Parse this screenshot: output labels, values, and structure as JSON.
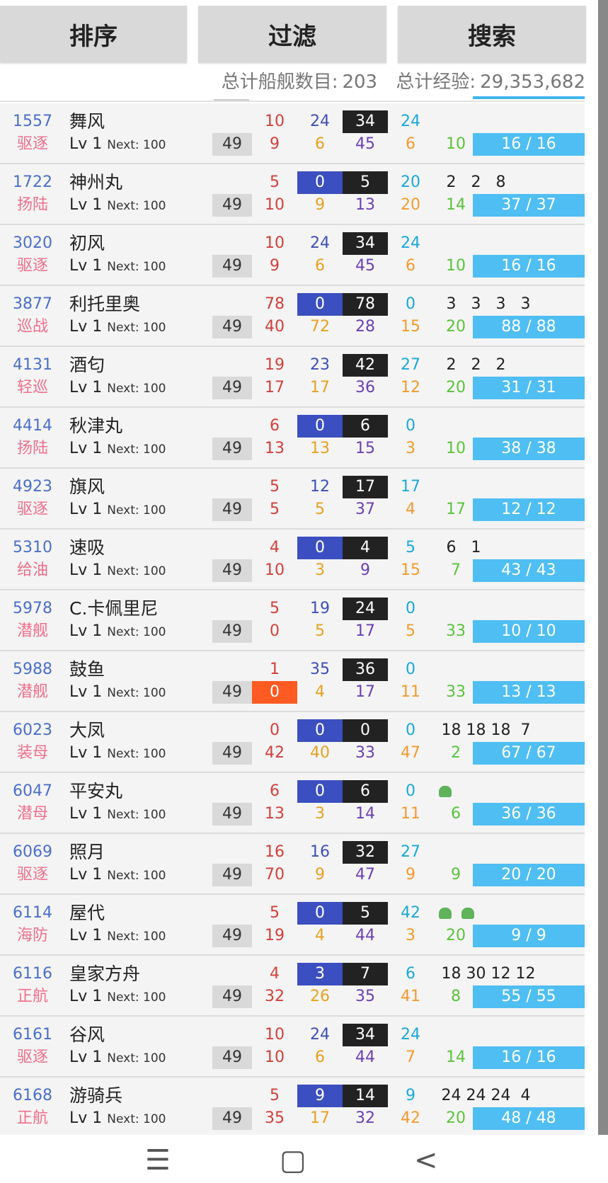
{
  "toolbar": {
    "sort_label": "排序",
    "filter_label": "过滤",
    "search_label": "搜索"
  },
  "summary": {
    "ships_label": "总计船舰数目:",
    "ships_value": "203",
    "exp_label": "总计经验:",
    "exp_value": "29,353,682"
  },
  "level_prefix": "Lv 1",
  "next_text": "Next: 100",
  "nav": {
    "menu_icon": "menu-icon",
    "home_icon": "home-icon",
    "back_icon": "back-icon"
  },
  "colors": {
    "accent": "#4fbef2",
    "torpedo_box": "#3b4fc0",
    "total_box": "#222222",
    "warn_box": "#ff5a22"
  },
  "ships": [
    {
      "id": "1557",
      "type": "驱逐",
      "name": "舞风",
      "lvbox": "49",
      "r1": [
        "10",
        "24",
        "34",
        "24"
      ],
      "r2": [
        "9",
        "6",
        "45",
        "6",
        "10"
      ],
      "slots": [],
      "hp": "16 / 16",
      "torp_box": false,
      "warn": false
    },
    {
      "id": "1722",
      "type": "扬陆",
      "name": "神州丸",
      "lvbox": "49",
      "r1": [
        "5",
        "0",
        "5",
        "20"
      ],
      "r2": [
        "10",
        "9",
        "13",
        "20",
        "14"
      ],
      "slots": [
        "2",
        "2",
        "8"
      ],
      "hp": "37 / 37",
      "torp_box": true,
      "warn": false
    },
    {
      "id": "3020",
      "type": "驱逐",
      "name": "初风",
      "lvbox": "49",
      "r1": [
        "10",
        "24",
        "34",
        "24"
      ],
      "r2": [
        "9",
        "6",
        "45",
        "6",
        "10"
      ],
      "slots": [],
      "hp": "16 / 16",
      "torp_box": false,
      "warn": false
    },
    {
      "id": "3877",
      "type": "巡战",
      "name": "利托里奥",
      "lvbox": "49",
      "r1": [
        "78",
        "0",
        "78",
        "0"
      ],
      "r2": [
        "40",
        "72",
        "28",
        "15",
        "20"
      ],
      "slots": [
        "3",
        "3",
        "3",
        "3"
      ],
      "hp": "88 / 88",
      "torp_box": true,
      "warn": false
    },
    {
      "id": "4131",
      "type": "轻巡",
      "name": "酒匂",
      "lvbox": "49",
      "r1": [
        "19",
        "23",
        "42",
        "27"
      ],
      "r2": [
        "17",
        "17",
        "36",
        "12",
        "20"
      ],
      "slots": [
        "2",
        "2",
        "2"
      ],
      "hp": "31 / 31",
      "torp_box": false,
      "warn": false
    },
    {
      "id": "4414",
      "type": "扬陆",
      "name": "秋津丸",
      "lvbox": "49",
      "r1": [
        "6",
        "0",
        "6",
        "0"
      ],
      "r2": [
        "13",
        "13",
        "15",
        "3",
        "10"
      ],
      "slots": [],
      "hp": "38 / 38",
      "torp_box": true,
      "warn": false
    },
    {
      "id": "4923",
      "type": "驱逐",
      "name": "旗风",
      "lvbox": "49",
      "r1": [
        "5",
        "12",
        "17",
        "17"
      ],
      "r2": [
        "5",
        "5",
        "37",
        "4",
        "17"
      ],
      "slots": [],
      "hp": "12 / 12",
      "torp_box": false,
      "warn": false
    },
    {
      "id": "5310",
      "type": "给油",
      "name": "速吸",
      "lvbox": "49",
      "r1": [
        "4",
        "0",
        "4",
        "5"
      ],
      "r2": [
        "10",
        "3",
        "9",
        "15",
        "7"
      ],
      "slots": [
        "6",
        "1"
      ],
      "hp": "43 / 43",
      "torp_box": true,
      "warn": false
    },
    {
      "id": "5978",
      "type": "潜舰",
      "name": "C.卡佩里尼",
      "lvbox": "49",
      "r1": [
        "5",
        "19",
        "24",
        "0"
      ],
      "r2": [
        "0",
        "5",
        "17",
        "5",
        "33"
      ],
      "slots": [],
      "hp": "10 / 10",
      "torp_box": false,
      "warn": false
    },
    {
      "id": "5988",
      "type": "潜舰",
      "name": "鼓鱼",
      "lvbox": "49",
      "r1": [
        "1",
        "35",
        "36",
        "0"
      ],
      "r2": [
        "0",
        "4",
        "17",
        "11",
        "33"
      ],
      "slots": [],
      "hp": "13 / 13",
      "torp_box": false,
      "warn": true
    },
    {
      "id": "6023",
      "type": "装母",
      "name": "大凤",
      "lvbox": "49",
      "r1": [
        "0",
        "0",
        "0",
        "0"
      ],
      "r2": [
        "42",
        "40",
        "33",
        "47",
        "2"
      ],
      "slots": [
        "18",
        "18",
        "18",
        "7"
      ],
      "hp": "67 / 67",
      "torp_box": true,
      "warn": false
    },
    {
      "id": "6047",
      "type": "潜母",
      "name": "平安丸",
      "lvbox": "49",
      "r1": [
        "6",
        "0",
        "6",
        "0"
      ],
      "r2": [
        "13",
        "3",
        "14",
        "11",
        "6"
      ],
      "slots": [],
      "icons": [
        "green"
      ],
      "hp": "36 / 36",
      "torp_box": true,
      "warn": false
    },
    {
      "id": "6069",
      "type": "驱逐",
      "name": "照月",
      "lvbox": "49",
      "r1": [
        "16",
        "16",
        "32",
        "27"
      ],
      "r2": [
        "70",
        "9",
        "47",
        "9",
        "9"
      ],
      "slots": [],
      "hp": "20 / 20",
      "torp_box": false,
      "warn": false
    },
    {
      "id": "6114",
      "type": "海防",
      "name": "屋代",
      "lvbox": "49",
      "r1": [
        "5",
        "0",
        "5",
        "42"
      ],
      "r2": [
        "19",
        "4",
        "44",
        "3",
        "20"
      ],
      "slots": [],
      "icons": [
        "green",
        "green"
      ],
      "hp": "9 / 9",
      "torp_box": true,
      "warn": false
    },
    {
      "id": "6116",
      "type": "正航",
      "name": "皇家方舟",
      "lvbox": "49",
      "r1": [
        "4",
        "3",
        "7",
        "6"
      ],
      "r2": [
        "32",
        "26",
        "35",
        "41",
        "8"
      ],
      "slots": [
        "18",
        "30",
        "12",
        "12"
      ],
      "hp": "55 / 55",
      "torp_box": true,
      "warn": false
    },
    {
      "id": "6161",
      "type": "驱逐",
      "name": "谷风",
      "lvbox": "49",
      "r1": [
        "10",
        "24",
        "34",
        "24"
      ],
      "r2": [
        "10",
        "6",
        "44",
        "7",
        "14"
      ],
      "slots": [],
      "hp": "16 / 16",
      "torp_box": false,
      "warn": false
    },
    {
      "id": "6168",
      "type": "正航",
      "name": "游骑兵",
      "lvbox": "49",
      "r1": [
        "5",
        "9",
        "14",
        "9"
      ],
      "r2": [
        "35",
        "17",
        "32",
        "42",
        "20"
      ],
      "slots": [
        "24",
        "24",
        "24",
        "4"
      ],
      "hp": "48 / 48",
      "torp_box": true,
      "warn": false
    }
  ]
}
